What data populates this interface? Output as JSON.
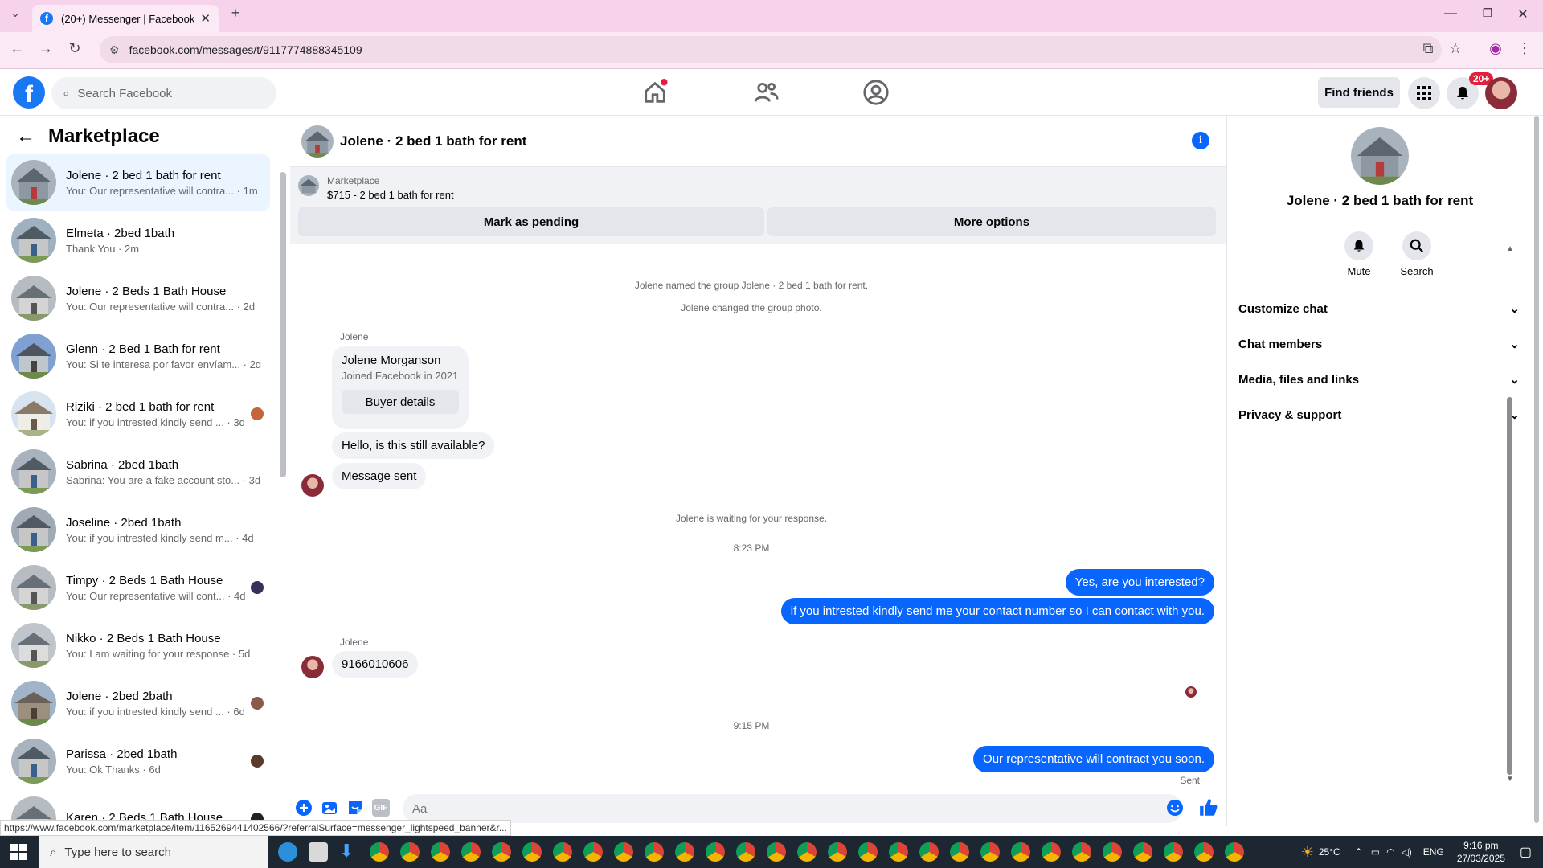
{
  "browser": {
    "tab_title": "(20+) Messenger | Facebook",
    "url": "facebook.com/messages/t/9117774888345109",
    "status_url": "https://www.facebook.com/marketplace/item/1165269441402566/?referralSurface=messenger_lightspeed_banner&r..."
  },
  "fb": {
    "search_placeholder": "Search Facebook",
    "find_friends": "Find friends",
    "notif_badge": "20+"
  },
  "sidebar": {
    "title": "Marketplace",
    "conversations": [
      {
        "name": "Jolene · 2 bed 1 bath for rent",
        "preview": "You: Our representative will contra... · 1m",
        "active": true
      },
      {
        "name": "Elmeta · 2bed 1bath",
        "preview": "Thank You · 2m"
      },
      {
        "name": "Jolene · 2 Beds 1 Bath House",
        "preview": "You: Our representative will contra... · 2d"
      },
      {
        "name": "Glenn · 2 Bed 1 Bath for rent",
        "preview": "You: Si te interesa por favor envíam... · 2d"
      },
      {
        "name": "Riziki · 2 bed 1 bath for rent",
        "preview": "You: if you intrested kindly send ... · 3d"
      },
      {
        "name": "Sabrina · 2bed 1bath",
        "preview": "Sabrina: You are a fake account sto... · 3d"
      },
      {
        "name": "Joseline · 2bed 1bath",
        "preview": "You: if you intrested kindly send m... · 4d"
      },
      {
        "name": "Timpy · 2 Beds 1 Bath House",
        "preview": "You: Our representative will cont... · 4d"
      },
      {
        "name": "Nikko · 2 Beds 1 Bath House",
        "preview": "You: I am waiting for your response · 5d"
      },
      {
        "name": "Jolene · 2bed 2bath",
        "preview": "You: if you intrested kindly send ... · 6d"
      },
      {
        "name": "Parissa · 2bed 1bath",
        "preview": "You: Ok Thanks · 6d"
      },
      {
        "name": "Karen · 2 Beds 1 Bath House",
        "preview": ""
      }
    ]
  },
  "chat": {
    "title": "Jolene · 2 bed 1 bath for rent",
    "banner_source": "Marketplace",
    "banner_price": "$715 - 2 bed 1 bath for rent",
    "mark_pending": "Mark as pending",
    "more_options": "More options",
    "sys1": "Jolene named the group Jolene · 2 bed 1 bath for rent.",
    "sys2": "Jolene changed the group photo.",
    "sender1": "Jolene",
    "profile_name": "Jolene Morganson",
    "profile_joined": "Joined Facebook in 2021",
    "buyer_details": "Buyer details",
    "msg_in1": "Hello, is this still available?",
    "msg_in2": "Message sent",
    "sys3": "Jolene is waiting for your response.",
    "time1": "8:23 PM",
    "msg_out1": "Yes, are you interested?",
    "msg_out2": "if you intrested kindly send me your contact number so I can contact with you.",
    "sender2": "Jolene",
    "msg_in3": "9166010606",
    "time2": "9:15 PM",
    "msg_out3": "Our representative will contract you soon.",
    "sent_label": "Sent",
    "input_placeholder": "Aa"
  },
  "right_panel": {
    "name": "Jolene · 2 bed 1 bath for rent",
    "mute": "Mute",
    "search": "Search",
    "sections": [
      "Customize chat",
      "Chat members",
      "Media, files and links",
      "Privacy & support"
    ]
  },
  "taskbar": {
    "search_placeholder": "Type here to search",
    "weather": "25°C",
    "lang": "ENG",
    "time": "9:16 pm",
    "date": "27/03/2025"
  },
  "colors": {
    "brand": "#1877f2",
    "message_out": "#0866ff",
    "chrome_pink": "#f6d3ea"
  }
}
